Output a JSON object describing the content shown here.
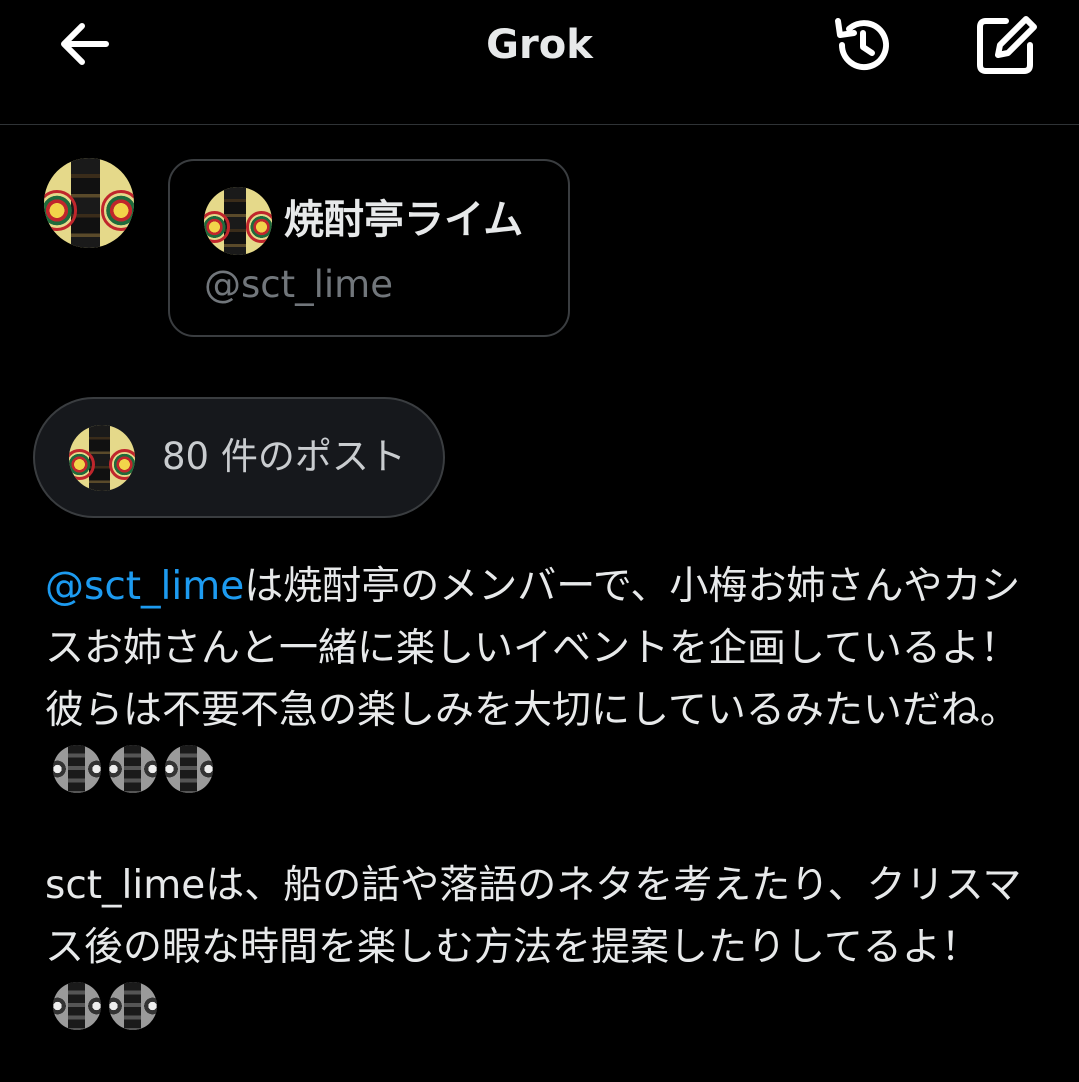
{
  "header": {
    "title": "Grok",
    "back_icon": "arrow-left-icon",
    "history_icon": "history-icon",
    "compose_icon": "compose-icon"
  },
  "profile_card": {
    "name": "焼酎亭ライム",
    "handle": "@sct_lime"
  },
  "posts_pill": {
    "label": "80 件のポスト"
  },
  "reply": {
    "paragraph1_mention": "@sct_lime",
    "paragraph1_text": "は焼酎亭のメンバーで、小梅お姉さんやカシスお姉さんと一緒に楽しいイベントを企画しているよ！彼らは不要不急の楽しみを大切にしているみたいだね。",
    "paragraph1_emoji_count": 3,
    "paragraph2_text": "sct_limeは、船の話や落語のネタを考えたり、クリスマス後の暇な時間を楽しむ方法を提案したりしてるよ！",
    "paragraph2_emoji_count": 2
  },
  "colors": {
    "background": "#000000",
    "text": "#e7e9ea",
    "muted": "#71767b",
    "mention": "#1d9bf0",
    "border": "#3a3d40"
  }
}
